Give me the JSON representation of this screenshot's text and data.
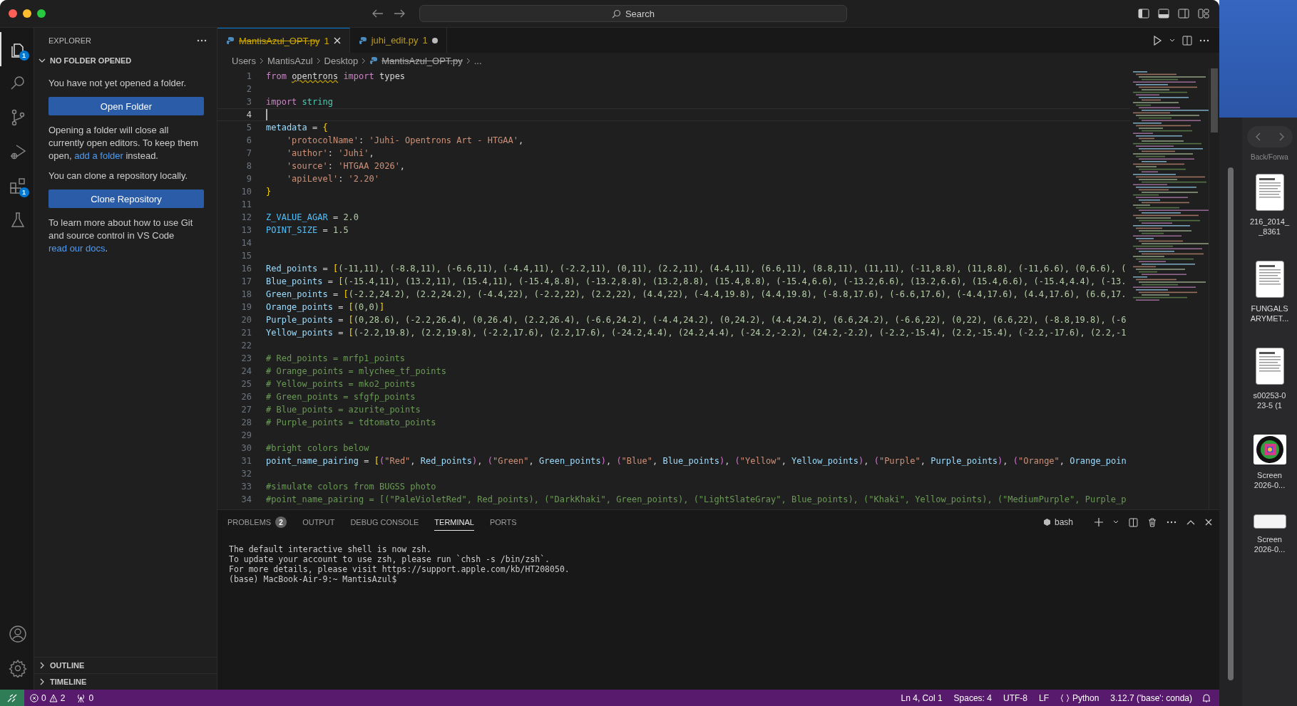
{
  "titlebar": {
    "search": "Search"
  },
  "activity_bar": {
    "items": [
      {
        "kind": "explorer",
        "selected": true,
        "badge": "1"
      },
      {
        "kind": "search",
        "selected": false
      },
      {
        "kind": "source-control",
        "selected": false
      },
      {
        "kind": "run-debug",
        "selected": false
      },
      {
        "kind": "extensions",
        "selected": false,
        "badge": "1"
      },
      {
        "kind": "testing",
        "selected": false
      }
    ],
    "bottom": [
      {
        "kind": "account"
      },
      {
        "kind": "settings"
      }
    ]
  },
  "sidebar": {
    "title": "EXPLORER",
    "section": {
      "title": "NO FOLDER OPENED",
      "expanded": true,
      "content": [
        {
          "kind": "text",
          "parts": [
            {
              "text": "You have not yet opened a folder.",
              "kind": "plain"
            }
          ]
        },
        {
          "kind": "button",
          "label": "Open Folder"
        },
        {
          "kind": "text",
          "parts": [
            {
              "text": "Opening a folder will close all currently open editors. To keep them open, ",
              "kind": "plain"
            },
            {
              "text": "add a folder",
              "kind": "link"
            },
            {
              "text": " instead.",
              "kind": "plain"
            }
          ]
        },
        {
          "kind": "text",
          "parts": [
            {
              "text": "You can clone a repository locally.",
              "kind": "plain"
            }
          ]
        },
        {
          "kind": "button",
          "label": "Clone Repository"
        },
        {
          "kind": "text",
          "parts": [
            {
              "text": "To learn more about how to use Git and source control in VS Code ",
              "kind": "plain"
            },
            {
              "text": "read our docs",
              "kind": "link"
            },
            {
              "text": ".",
              "kind": "plain"
            }
          ]
        }
      ]
    },
    "collapsed_sections": [
      {
        "title": "OUTLINE",
        "expanded": false
      },
      {
        "title": "TIMELINE",
        "expanded": false
      }
    ]
  },
  "tabs": [
    {
      "label": "MantisAzul_OPT.py",
      "problems": "1",
      "selected": true,
      "deleted": true,
      "dirty": false
    },
    {
      "label": "juhi_edit.py",
      "problems": "1",
      "selected": false,
      "deleted": false,
      "dirty": true
    }
  ],
  "breadcrumbs": {
    "path": [
      "Users",
      "MantisAzul",
      "Desktop"
    ],
    "file": {
      "name": "MantisAzul_OPT.py",
      "deleted": true
    },
    "more": "..."
  },
  "editor": {
    "lines": [
      {
        "number": "1",
        "current": false,
        "tokens": [
          {
            "text": "from ",
            "kind": "kw"
          },
          {
            "text": "opentrons",
            "kind": "warn"
          },
          {
            "text": " import",
            "kind": "kw"
          },
          {
            "text": " types",
            "kind": "op"
          }
        ]
      },
      {
        "number": "2",
        "current": false
      },
      {
        "number": "3",
        "current": false,
        "tokens": [
          {
            "text": "import ",
            "kind": "kw"
          },
          {
            "text": "string",
            "kind": "mod"
          }
        ]
      },
      {
        "number": "4",
        "current": true
      },
      {
        "number": "5",
        "current": false,
        "tokens": [
          {
            "text": "metadata",
            "kind": "var"
          },
          {
            "text": " = ",
            "kind": "op"
          },
          {
            "text": "{",
            "kind": "br1"
          }
        ]
      },
      {
        "number": "6",
        "current": false,
        "tokens": [
          {
            "text": "    'protocolName'",
            "kind": "str"
          },
          {
            "text": ": ",
            "kind": "op"
          },
          {
            "text": "'Juhi- Opentrons Art - HTGAA'",
            "kind": "str"
          },
          {
            "text": ",",
            "kind": "op"
          }
        ]
      },
      {
        "number": "7",
        "current": false,
        "tokens": [
          {
            "text": "    'author'",
            "kind": "str"
          },
          {
            "text": ": ",
            "kind": "op"
          },
          {
            "text": "'Juhi'",
            "kind": "str"
          },
          {
            "text": ",",
            "kind": "op"
          }
        ]
      },
      {
        "number": "8",
        "current": false,
        "tokens": [
          {
            "text": "    'source'",
            "kind": "str"
          },
          {
            "text": ": ",
            "kind": "op"
          },
          {
            "text": "'HTGAA 2026'",
            "kind": "str"
          },
          {
            "text": ",",
            "kind": "op"
          }
        ]
      },
      {
        "number": "9",
        "current": false,
        "tokens": [
          {
            "text": "    'apiLevel'",
            "kind": "str"
          },
          {
            "text": ": ",
            "kind": "op"
          },
          {
            "text": "'2.20'",
            "kind": "str"
          }
        ]
      },
      {
        "number": "10",
        "current": false,
        "tokens": [
          {
            "text": "}",
            "kind": "br1"
          }
        ]
      },
      {
        "number": "11",
        "current": false
      },
      {
        "number": "12",
        "current": false,
        "tokens": [
          {
            "text": "Z_VALUE_AGAR",
            "kind": "const"
          },
          {
            "text": " = ",
            "kind": "op"
          },
          {
            "text": "2.0",
            "kind": "num"
          }
        ]
      },
      {
        "number": "13",
        "current": false,
        "tokens": [
          {
            "text": "POINT_SIZE",
            "kind": "const"
          },
          {
            "text": " = ",
            "kind": "op"
          },
          {
            "text": "1.5",
            "kind": "num"
          }
        ]
      },
      {
        "number": "14",
        "current": false
      },
      {
        "number": "15",
        "current": false
      },
      {
        "number": "16",
        "current": false,
        "tokens": [
          {
            "text": "Red_points",
            "kind": "var"
          },
          {
            "text": " = ",
            "kind": "op"
          },
          {
            "text": "[",
            "kind": "br1"
          },
          {
            "text": "(-11,11), (-8.8,11), (-6.6,11), (-4.4,11), (-2.2,11), (0,11), (2.2,11), (4.4,11), (6.6,11), (8.8,11), (11,11), (-11,8.8), (11,8.8), (-11,6.6), (0,6.6), (",
            "kind": "num"
          }
        ]
      },
      {
        "number": "17",
        "current": false,
        "tokens": [
          {
            "text": "Blue_points",
            "kind": "var"
          },
          {
            "text": " = ",
            "kind": "op"
          },
          {
            "text": "[",
            "kind": "br1"
          },
          {
            "text": "(-15.4,11), (13.2,11), (15.4,11), (-15.4,8.8), (-13.2,8.8), (13.2,8.8), (15.4,8.8), (-15.4,6.6), (-13.2,6.6), (13.2,6.6), (15.4,6.6), (-15.4,4.4), (-13.",
            "kind": "num"
          }
        ]
      },
      {
        "number": "18",
        "current": false,
        "tokens": [
          {
            "text": "Green_points",
            "kind": "var"
          },
          {
            "text": " = ",
            "kind": "op"
          },
          {
            "text": "[",
            "kind": "br1"
          },
          {
            "text": "(-2.2,24.2), (2.2,24.2), (-4.4,22), (-2.2,22), (2.2,22), (4.4,22), (-4.4,19.8), (4.4,19.8), (-8.8,17.6), (-6.6,17.6), (-4.4,17.6), (4.4,17.6), (6.6,17.",
            "kind": "num"
          }
        ]
      },
      {
        "number": "19",
        "current": false,
        "tokens": [
          {
            "text": "Orange_points",
            "kind": "var"
          },
          {
            "text": " = ",
            "kind": "op"
          },
          {
            "text": "[",
            "kind": "br1"
          },
          {
            "text": "(0,0)",
            "kind": "num"
          },
          {
            "text": "]",
            "kind": "br1"
          }
        ]
      },
      {
        "number": "20",
        "current": false,
        "tokens": [
          {
            "text": "Purple_points",
            "kind": "var"
          },
          {
            "text": " = ",
            "kind": "op"
          },
          {
            "text": "[",
            "kind": "br1"
          },
          {
            "text": "(0,28.6), (-2.2,26.4), (0,26.4), (2.2,26.4), (-6.6,24.2), (-4.4,24.2), (0,24.2), (4.4,24.2), (6.6,24.2), (-6.6,22), (0,22), (6.6,22), (-8.8,19.8), (-6",
            "kind": "num"
          }
        ]
      },
      {
        "number": "21",
        "current": false,
        "tokens": [
          {
            "text": "Yellow_points",
            "kind": "var"
          },
          {
            "text": " = ",
            "kind": "op"
          },
          {
            "text": "[",
            "kind": "br1"
          },
          {
            "text": "(-2.2,19.8), (2.2,19.8), (-2.2,17.6), (2.2,17.6), (-24.2,4.4), (24.2,4.4), (-24.2,-2.2), (24.2,-2.2), (-2.2,-15.4), (2.2,-15.4), (-2.2,-17.6), (2.2,-1",
            "kind": "num"
          }
        ]
      },
      {
        "number": "22",
        "current": false
      },
      {
        "number": "23",
        "current": false,
        "tokens": [
          {
            "text": "# Red_points = mrfp1_points",
            "kind": "cmt"
          }
        ]
      },
      {
        "number": "24",
        "current": false,
        "tokens": [
          {
            "text": "# Orange_points = mlychee_tf_points",
            "kind": "cmt"
          }
        ]
      },
      {
        "number": "25",
        "current": false,
        "tokens": [
          {
            "text": "# Yellow_points = mko2_points",
            "kind": "cmt"
          }
        ]
      },
      {
        "number": "26",
        "current": false,
        "tokens": [
          {
            "text": "# Green_points = sfgfp_points",
            "kind": "cmt"
          }
        ]
      },
      {
        "number": "27",
        "current": false,
        "tokens": [
          {
            "text": "# Blue_points = azurite_points",
            "kind": "cmt"
          }
        ]
      },
      {
        "number": "28",
        "current": false,
        "tokens": [
          {
            "text": "# Purple_points = tdtomato_points",
            "kind": "cmt"
          }
        ]
      },
      {
        "number": "29",
        "current": false
      },
      {
        "number": "30",
        "current": false,
        "tokens": [
          {
            "text": "#bright colors below",
            "kind": "cmt"
          }
        ]
      },
      {
        "number": "31",
        "current": false,
        "tokens": [
          {
            "text": "point_name_pairing",
            "kind": "var"
          },
          {
            "text": " = ",
            "kind": "op"
          },
          {
            "text": "[",
            "kind": "br1"
          },
          {
            "text": "(",
            "kind": "br2"
          },
          {
            "text": "\"Red\"",
            "kind": "str"
          },
          {
            "text": ", ",
            "kind": "op"
          },
          {
            "text": "Red_points",
            "kind": "var"
          },
          {
            "text": ")",
            "kind": "br2"
          },
          {
            "text": ", ",
            "kind": "op"
          },
          {
            "text": "(",
            "kind": "br2"
          },
          {
            "text": "\"Green\"",
            "kind": "str"
          },
          {
            "text": ", ",
            "kind": "op"
          },
          {
            "text": "Green_points",
            "kind": "var"
          },
          {
            "text": ")",
            "kind": "br2"
          },
          {
            "text": ", ",
            "kind": "op"
          },
          {
            "text": "(",
            "kind": "br2"
          },
          {
            "text": "\"Blue\"",
            "kind": "str"
          },
          {
            "text": ", ",
            "kind": "op"
          },
          {
            "text": "Blue_points",
            "kind": "var"
          },
          {
            "text": ")",
            "kind": "br2"
          },
          {
            "text": ", ",
            "kind": "op"
          },
          {
            "text": "(",
            "kind": "br2"
          },
          {
            "text": "\"Yellow\"",
            "kind": "str"
          },
          {
            "text": ", ",
            "kind": "op"
          },
          {
            "text": "Yellow_points",
            "kind": "var"
          },
          {
            "text": ")",
            "kind": "br2"
          },
          {
            "text": ", ",
            "kind": "op"
          },
          {
            "text": "(",
            "kind": "br2"
          },
          {
            "text": "\"Purple\"",
            "kind": "str"
          },
          {
            "text": ", ",
            "kind": "op"
          },
          {
            "text": "Purple_points",
            "kind": "var"
          },
          {
            "text": ")",
            "kind": "br2"
          },
          {
            "text": ", ",
            "kind": "op"
          },
          {
            "text": "(",
            "kind": "br2"
          },
          {
            "text": "\"Orange\"",
            "kind": "str"
          },
          {
            "text": ", ",
            "kind": "op"
          },
          {
            "text": "Orange_poin",
            "kind": "var"
          }
        ]
      },
      {
        "number": "32",
        "current": false
      },
      {
        "number": "33",
        "current": false,
        "tokens": [
          {
            "text": "#simulate colors from BUGSS photo",
            "kind": "cmt"
          }
        ]
      },
      {
        "number": "34",
        "current": false,
        "tokens": [
          {
            "text": "#point_name_pairing = [(\"PaleVioletRed\", Red_points), (\"DarkKhaki\", Green_points), (\"LightSlateGray\", Blue_points), (\"Khaki\", Yellow_points), (\"MediumPurple\", Purple_p",
            "kind": "cmt"
          }
        ]
      }
    ]
  },
  "panel": {
    "tabs": [
      {
        "label": "PROBLEMS",
        "badge": "2",
        "selected": false
      },
      {
        "label": "OUTPUT",
        "selected": false
      },
      {
        "label": "DEBUG CONSOLE",
        "selected": false
      },
      {
        "label": "TERMINAL",
        "selected": true
      },
      {
        "label": "PORTS",
        "selected": false
      }
    ],
    "shell": "bash",
    "terminal": [
      "The default interactive shell is now zsh.",
      "To update your account to use zsh, please run `chsh -s /bin/zsh`.",
      "For more details, please visit https://support.apple.com/kb/HT208050.",
      "(base) MacBook-Air-9:~ MantisAzul$"
    ]
  },
  "status_bar": {
    "errors": "0",
    "warnings": "2",
    "ports": "0",
    "right": [
      {
        "text": "Ln 4, Col 1",
        "kind": "plain"
      },
      {
        "text": "Spaces: 4",
        "kind": "plain"
      },
      {
        "text": "UTF-8",
        "kind": "plain"
      },
      {
        "text": "LF",
        "kind": "plain"
      },
      {
        "text": "Python",
        "kind": "language"
      },
      {
        "text": "3.12.7 ('base': conda)",
        "kind": "plain"
      }
    ]
  },
  "finder": {
    "nav_label": "Back/Forwa",
    "files": [
      {
        "kind": "document",
        "lines": [
          "216_2014_",
          "_8361"
        ]
      },
      {
        "kind": "document",
        "lines": [
          "FUNGALS",
          "ARYMET..."
        ]
      },
      {
        "kind": "document",
        "lines": [
          "s00253-0",
          "23-5 (1"
        ]
      },
      {
        "lines": [
          "Screen",
          "2026-0..."
        ]
      },
      {
        "kind": "wide",
        "lines": [
          "Screen",
          "2026-0..."
        ]
      }
    ]
  }
}
